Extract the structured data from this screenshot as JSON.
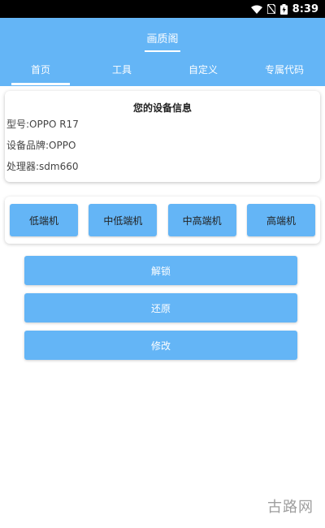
{
  "status_bar": {
    "time": "8:39"
  },
  "app_bar": {
    "title": "画质阁"
  },
  "tabs": [
    {
      "label": "首页",
      "active": true
    },
    {
      "label": "工具",
      "active": false
    },
    {
      "label": "自定义",
      "active": false
    },
    {
      "label": "专属代码",
      "active": false
    }
  ],
  "device_info": {
    "title": "您的设备信息",
    "model": "型号:OPPO R17",
    "brand": "设备品牌:OPPO",
    "processor": "处理器:sdm660"
  },
  "tiers": [
    {
      "label": "低端机"
    },
    {
      "label": "中低端机"
    },
    {
      "label": "中高端机"
    },
    {
      "label": "高端机"
    }
  ],
  "actions": {
    "unlock": "解锁",
    "restore": "还原",
    "modify": "修改"
  },
  "watermark": "古路网",
  "colors": {
    "primary": "#64b5f6",
    "status_bar": "#000000"
  }
}
